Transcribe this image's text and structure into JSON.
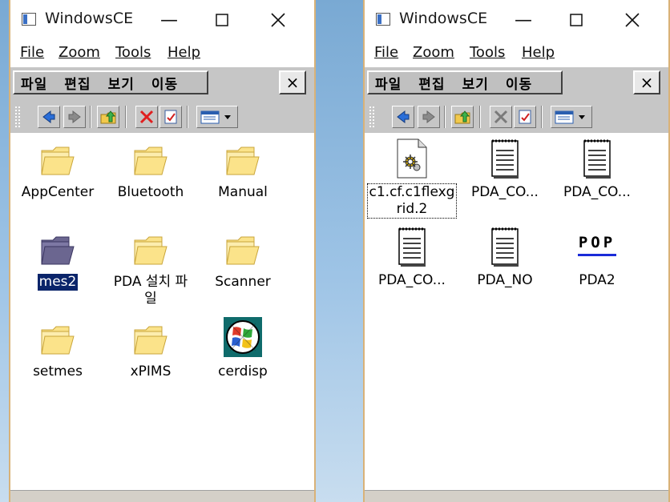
{
  "colors": {
    "folder_fill": "#fbe38a",
    "folder_edge": "#c9a53a",
    "highlight": "#0a246a"
  },
  "left_window": {
    "title": "WindowsCE",
    "menus": [
      "File",
      "Zoom",
      "Tools",
      "Help"
    ],
    "korean_menus": [
      "파일",
      "편집",
      "보기",
      "이동"
    ],
    "close_label": "×",
    "items": [
      {
        "label": "AppCenter",
        "icon": "folder-icon"
      },
      {
        "label": "Bluetooth",
        "icon": "folder-icon"
      },
      {
        "label": "Manual",
        "icon": "folder-icon"
      },
      {
        "label": "mes2",
        "icon": "folder-selected-icon",
        "selected": true
      },
      {
        "label": "PDA 설치 파\n일",
        "icon": "folder-icon"
      },
      {
        "label": "Scanner",
        "icon": "folder-icon"
      },
      {
        "label": "setmes",
        "icon": "folder-icon"
      },
      {
        "label": "xPIMS",
        "icon": "folder-icon"
      },
      {
        "label": "cerdisp",
        "icon": "windows-logo-icon"
      }
    ]
  },
  "right_window": {
    "title": "WindowsCE",
    "menus": [
      "File",
      "Zoom",
      "Tools",
      "Help"
    ],
    "korean_menus": [
      "파일",
      "편집",
      "보기",
      "이동"
    ],
    "close_label": "×",
    "items": [
      {
        "label": "c1.cf.c1flexg\nrid.2",
        "icon": "gear-document-icon",
        "focused": true
      },
      {
        "label": "PDA_CO...",
        "icon": "notepad-icon"
      },
      {
        "label": "PDA_CO...",
        "icon": "notepad-icon"
      },
      {
        "label": "PDA_CO...",
        "icon": "notepad-icon"
      },
      {
        "label": "PDA_NO",
        "icon": "notepad-icon"
      },
      {
        "label": "PDA2",
        "icon": "pop-logo-icon",
        "icon_text": "POP"
      }
    ]
  }
}
